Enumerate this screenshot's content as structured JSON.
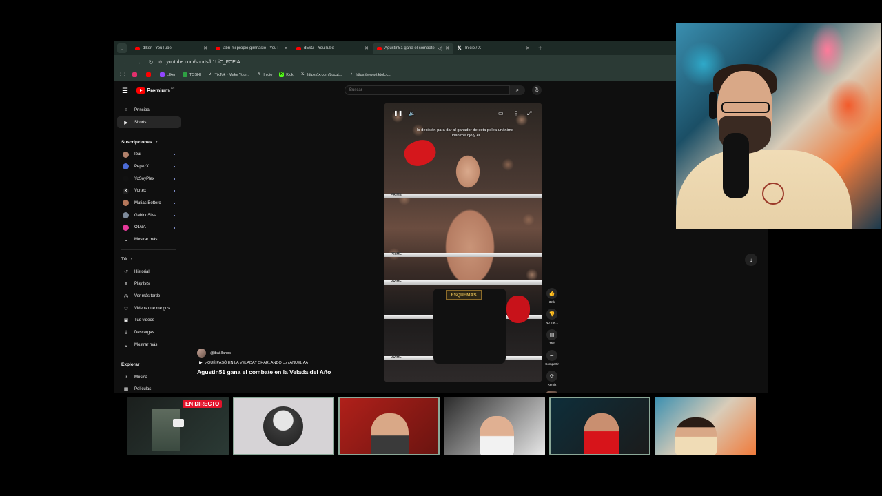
{
  "browser": {
    "tabs": [
      {
        "title": "dlker - YouTube",
        "active": false
      },
      {
        "title": "abri mi propio gimnasio - YouT",
        "active": false
      },
      {
        "title": "dEkG - YouTube",
        "active": false
      },
      {
        "title": "Agustin51 gana el combate",
        "active": true
      },
      {
        "title": "Inicio / X",
        "active": false
      }
    ],
    "url": "youtube.com/shorts/b1UiC_FCEIA",
    "bookmarks": [
      {
        "label": "",
        "color": "#e1306c"
      },
      {
        "label": "",
        "color": "#ff0000"
      },
      {
        "label": "cliker",
        "color": "#9146ff"
      },
      {
        "label": "TOSHI",
        "color": "#2ea043"
      },
      {
        "label": "TikTok - Make Your...",
        "color": "#111111"
      },
      {
        "label": "Inicio",
        "color": "#111111"
      },
      {
        "label": "Kick",
        "color": "#53fc18"
      },
      {
        "label": "https://x.com/Locut...",
        "color": "#111111"
      },
      {
        "label": "https://www.tiktok.c...",
        "color": "#111111"
      }
    ]
  },
  "youtube": {
    "logo_text": "Premium",
    "logo_sup": "AR",
    "search_placeholder": "Buscar",
    "nav": [
      {
        "label": "Principal",
        "icon": "home-icon",
        "glyph": "⌂",
        "active": false
      },
      {
        "label": "Shorts",
        "icon": "shorts-icon",
        "glyph": "▶",
        "active": true
      }
    ],
    "subscriptions_header": "Suscripciones",
    "subscriptions": [
      {
        "label": "Ibai",
        "color": "#b0806a"
      },
      {
        "label": "PepazX",
        "color": "#4b6bd6"
      },
      {
        "label": "YoSoyPlex",
        "color": "#111111"
      },
      {
        "label": "Vortex",
        "color": "#222222"
      },
      {
        "label": "Matias Bottero",
        "color": "#b5775a"
      },
      {
        "label": "GabinoSilva",
        "color": "#7d8a9a"
      },
      {
        "label": "OLGA",
        "color": "#e5399a"
      }
    ],
    "show_more": "Mostrar más",
    "you_header": "Tú",
    "you_items": [
      {
        "label": "Historial",
        "glyph": "↺",
        "icon": "history-icon"
      },
      {
        "label": "Playlists",
        "glyph": "≡",
        "icon": "playlists-icon"
      },
      {
        "label": "Ver más tarde",
        "glyph": "◷",
        "icon": "watch-later-icon"
      },
      {
        "label": "Videos que me gus...",
        "glyph": "👍",
        "icon": "liked-videos-icon"
      },
      {
        "label": "Tus videos",
        "glyph": "▣",
        "icon": "your-videos-icon"
      },
      {
        "label": "Descargas",
        "glyph": "⤓",
        "icon": "downloads-icon"
      }
    ],
    "show_more_2": "Mostrar más",
    "explore_header": "Explorar",
    "explore_items": [
      {
        "label": "Música",
        "glyph": "♪",
        "icon": "music-icon"
      },
      {
        "label": "Películas",
        "glyph": "▦",
        "icon": "movies-icon"
      }
    ],
    "video": {
      "caption": "la decisión para dar al ganador de esta pelea unánime unánime ojo y el",
      "belt_text": "ESQUEMAS",
      "rope_text": "PRIME"
    },
    "actions": [
      {
        "label": "32 k",
        "glyph": "👍",
        "icon": "like-icon"
      },
      {
        "label": "No me ...",
        "glyph": "👎",
        "icon": "dislike-icon"
      },
      {
        "label": "152",
        "glyph": "▤",
        "icon": "comments-icon"
      },
      {
        "label": "Compartir",
        "glyph": "➦",
        "icon": "share-icon"
      },
      {
        "label": "Remix",
        "glyph": "⟳",
        "icon": "remix-icon"
      }
    ],
    "live": {
      "channel": "@ibai.llanos",
      "live_text": "¿QUÉ PASÓ EN LA VELADA? CHARLANDO con ANUEL AA",
      "short_title": "Agustin51 gana el combate en la Velada del Año"
    }
  },
  "streams": {
    "live_badge": "EN DIRECTO",
    "thumbs": [
      {
        "kind": "screen",
        "selected": false
      },
      {
        "kind": "avatar",
        "selected": true
      },
      {
        "kind": "red-room",
        "selected": true
      },
      {
        "kind": "studio",
        "selected": false
      },
      {
        "kind": "arsenal",
        "selected": true
      },
      {
        "kind": "graffiti",
        "selected": false
      }
    ]
  }
}
